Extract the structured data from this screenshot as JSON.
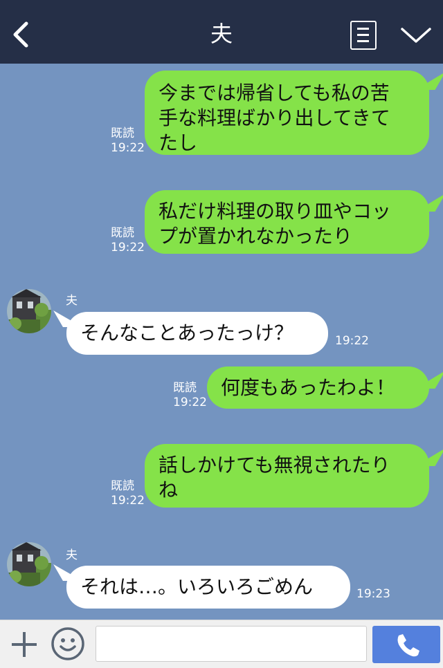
{
  "header": {
    "title": "夫"
  },
  "messages": [
    {
      "side": "out",
      "lines": [
        "今までは帰省しても私の苦",
        "手な料理ばかり出してきて",
        "たし"
      ],
      "read": "既読",
      "time": "19:22"
    },
    {
      "side": "out",
      "lines": [
        "私だけ料理の取り皿やコッ",
        "プが置かれなかったり"
      ],
      "read": "既読",
      "time": "19:22"
    },
    {
      "side": "in",
      "sender": "夫",
      "lines": [
        "そんなことあったっけ？"
      ],
      "time": "19:22"
    },
    {
      "side": "out",
      "lines": [
        "何度もあったわよ！"
      ],
      "read": "既読",
      "time": "19:22"
    },
    {
      "side": "out",
      "lines": [
        "話しかけても無視されたり",
        "ね"
      ],
      "read": "既読",
      "time": "19:22"
    },
    {
      "side": "in",
      "sender": "夫",
      "lines": [
        "それは…。いろいろごめん"
      ],
      "time": "19:23"
    }
  ],
  "footer": {
    "input_placeholder": ""
  },
  "colors": {
    "header": "#252f47",
    "background": "#7494c0",
    "outgoing": "#85e249",
    "incoming": "#ffffff",
    "call": "#5480dd"
  }
}
